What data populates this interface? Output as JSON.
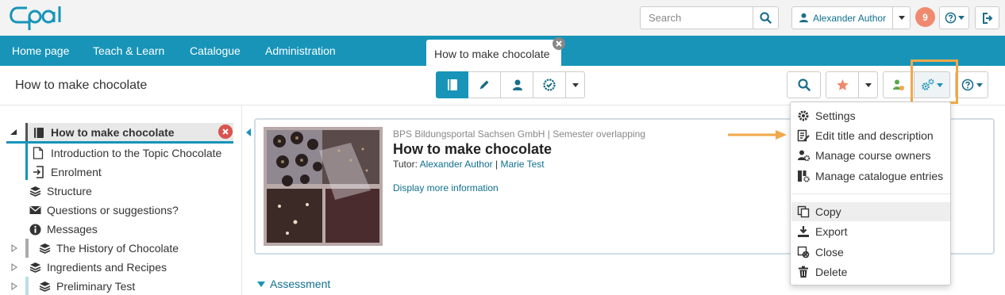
{
  "topbar": {
    "search": {
      "placeholder": "Search",
      "value": ""
    },
    "user_label": "Alexander Author",
    "notification_count": "9"
  },
  "nav": {
    "items": [
      {
        "label": "Home page"
      },
      {
        "label": "Teach & Learn"
      },
      {
        "label": "Catalogue"
      },
      {
        "label": "Administration"
      }
    ],
    "active_tab": "How to make chocolate"
  },
  "course_bar": {
    "title": "How to make chocolate"
  },
  "tree": {
    "root": "How to make chocolate",
    "items": [
      {
        "label": "Introduction to the Topic Chocolate",
        "icon": "page-icon"
      },
      {
        "label": "Enrolment",
        "icon": "enrolment-icon"
      },
      {
        "label": "Structure",
        "icon": "stack-icon"
      },
      {
        "label": "Questions or suggestions?",
        "icon": "mail-icon"
      },
      {
        "label": "Messages",
        "icon": "info-icon"
      },
      {
        "label": "The History of Chocolate",
        "icon": "stack-icon"
      },
      {
        "label": "Ingredients and Recipes",
        "icon": "stack-icon"
      },
      {
        "label": "Preliminary Test",
        "icon": "stack-icon"
      }
    ]
  },
  "course_info": {
    "organisation": "BPS Bildungsportal Sachsen GmbH | Semester overlapping",
    "title": "How to make chocolate",
    "tutor_label": "Tutor:",
    "tutors": [
      "Alexander Author",
      "Marie Test"
    ],
    "tutor_separator": "|",
    "more_info": "Display more information"
  },
  "assessment_label": "Assessment",
  "menu": {
    "items": [
      {
        "label": "Settings",
        "icon": "gear-icon"
      },
      {
        "label": "Edit title and description",
        "icon": "edit-icon"
      },
      {
        "label": "Manage course owners",
        "icon": "owners-icon"
      },
      {
        "label": "Manage catalogue entries",
        "icon": "catalogue-icon"
      }
    ],
    "items2": [
      {
        "label": "Copy",
        "icon": "copy-icon"
      },
      {
        "label": "Export",
        "icon": "export-icon"
      },
      {
        "label": "Close",
        "icon": "close-course-icon"
      },
      {
        "label": "Delete",
        "icon": "trash-icon"
      }
    ]
  },
  "colors": {
    "brand": "#1794b8",
    "highlight": "#f0a848",
    "badge": "#f08a6f",
    "link": "#0f6f8f"
  }
}
